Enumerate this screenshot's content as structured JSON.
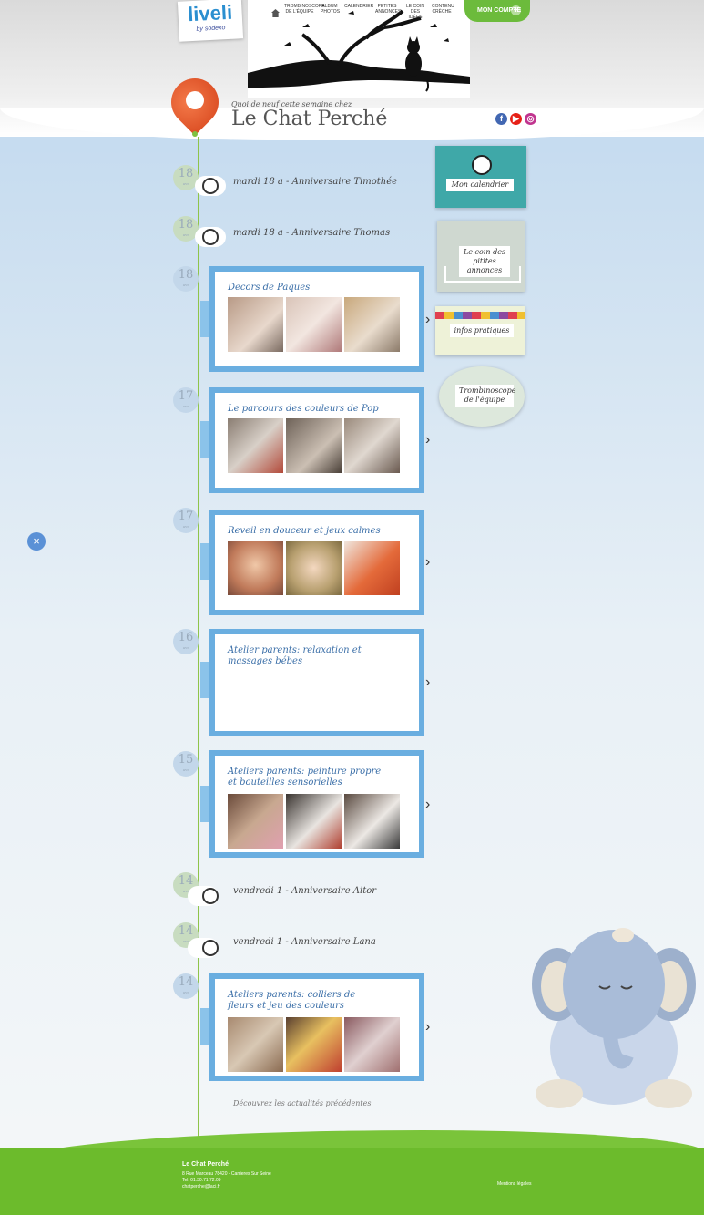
{
  "header": {
    "logo": {
      "main": "liveli",
      "tagline": "by sodexo"
    },
    "nav": [
      "Trombinoscope de l'équipe",
      "Album photos",
      "Calendrier",
      "Petites annonces",
      "Le coin des idées",
      "Contenu crèche"
    ],
    "account_button": "MON COMPTE",
    "subtitle": "Quoi de neuf cette semaine chez",
    "title": "Le Chat Perché",
    "social": [
      "f",
      "▶",
      "◎"
    ]
  },
  "timeline": [
    {
      "kind": "birthday",
      "day": "18",
      "month": "avr",
      "text": "mardi 18 a - Anniversaire Timothée"
    },
    {
      "kind": "birthday",
      "day": "18",
      "month": "avr",
      "text": "mardi 18 a - Anniversaire Thomas"
    },
    {
      "kind": "post",
      "day": "18",
      "month": "avr",
      "title": "Decors de Paques",
      "photos": 3
    },
    {
      "kind": "post",
      "day": "17",
      "month": "avr",
      "title": "Le parcours des couleurs de Pop",
      "photos": 3
    },
    {
      "kind": "post",
      "day": "17",
      "month": "avr",
      "title": "Reveil en douceur et jeux calmes",
      "photos": 3
    },
    {
      "kind": "post",
      "day": "16",
      "month": "avr",
      "title": "Atelier parents: relaxation et massages bébes",
      "photos": 0
    },
    {
      "kind": "post",
      "day": "15",
      "month": "avr",
      "title": "Ateliers parents: peinture propre et bouteilles sensorielles",
      "photos": 3
    },
    {
      "kind": "birthday",
      "day": "14",
      "month": "avr",
      "text": "vendredi 1 - Anniversaire Aitor"
    },
    {
      "kind": "birthday",
      "day": "14",
      "month": "avr",
      "text": "vendredi 1 - Anniversaire Lana"
    },
    {
      "kind": "post",
      "day": "14",
      "month": "avr",
      "title": "Ateliers parents: colliers de fleurs et jeu des couleurs",
      "photos": 3
    }
  ],
  "sidebar": [
    {
      "label": "Mon calendrier"
    },
    {
      "label": "Le coin des pitites annonces"
    },
    {
      "label": "infos pratiques"
    },
    {
      "label": "Trombinoscope de l'équipe"
    }
  ],
  "more_link": "Découvrez les actualités précédentes",
  "footer": {
    "name": "Le Chat Perché",
    "address": "8 Rue Marceau 78420 - Carrieres Sur Seine",
    "phone": "Tel: 01.30.71.72.09",
    "email": "chatperche@laci.fr",
    "legal": "Mentions légales"
  },
  "colors": {
    "accent": "#6aaee0",
    "green": "#6cbb2c",
    "pin": "#e2562a"
  }
}
